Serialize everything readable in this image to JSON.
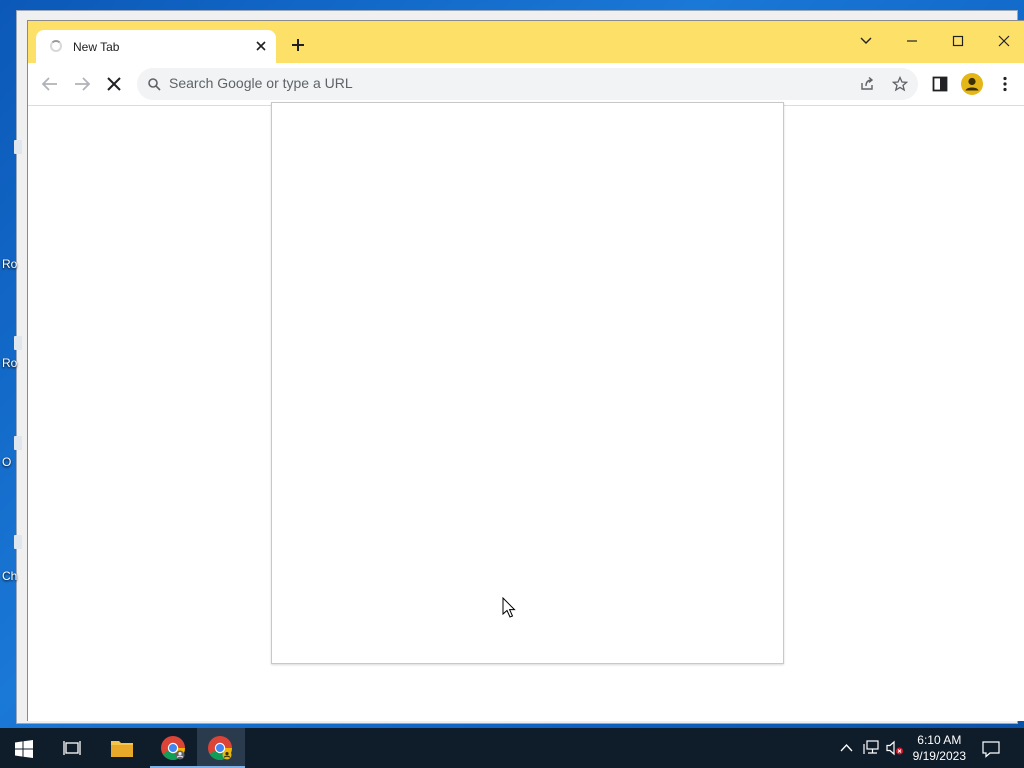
{
  "desktop": {
    "icons": [
      {
        "label": "Ro"
      },
      {
        "label": "Ro"
      },
      {
        "label": "O"
      },
      {
        "label": "Ch"
      }
    ]
  },
  "browser": {
    "tab": {
      "title": "New Tab"
    },
    "omnibox": {
      "placeholder": "Search Google or type a URL",
      "value": ""
    },
    "theme_color": "#fde068"
  },
  "taskbar": {
    "clock": {
      "time": "6:10 AM",
      "date": "9/19/2023"
    }
  }
}
